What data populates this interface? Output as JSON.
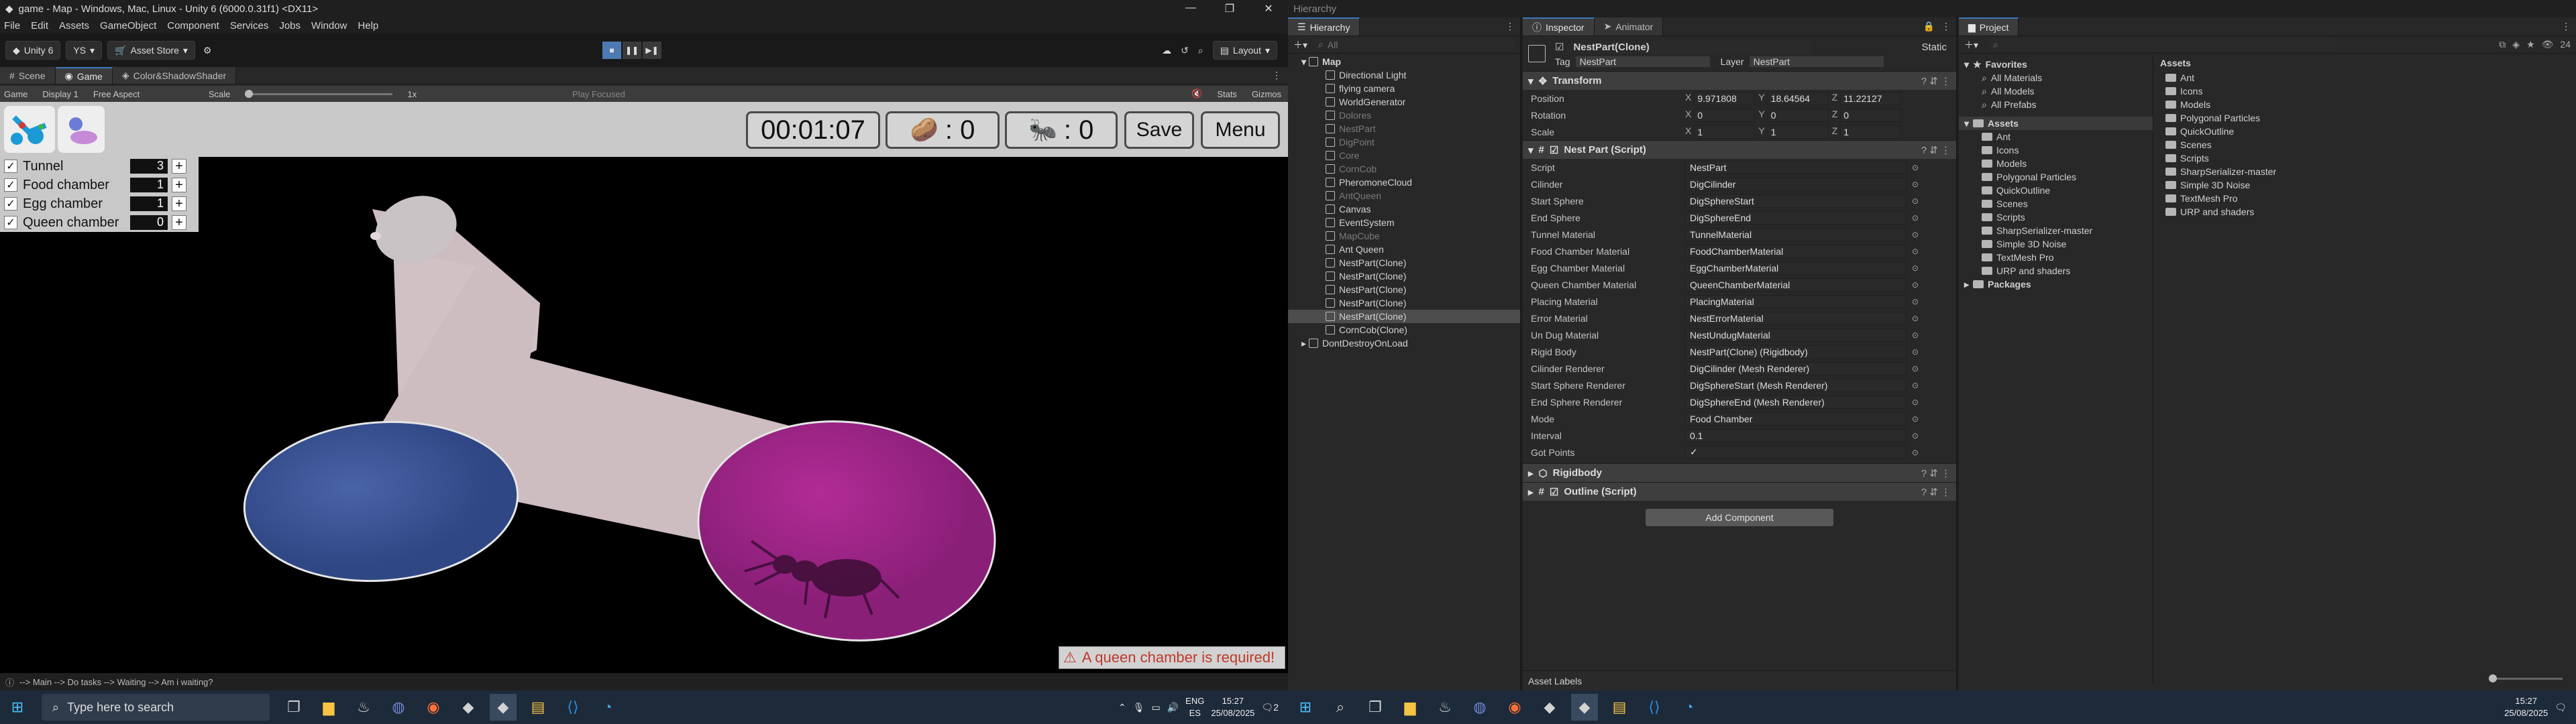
{
  "window": {
    "title": "game - Map - Windows, Mac, Linux - Unity 6 (6000.0.31f1) <DX11>",
    "controls": [
      "—",
      "❐",
      "✕"
    ]
  },
  "menu": [
    "File",
    "Edit",
    "Assets",
    "GameObject",
    "Component",
    "Services",
    "Jobs",
    "Window",
    "Help"
  ],
  "toolbar": {
    "unity": "Unity 6",
    "account": "YS",
    "store": "Asset Store",
    "layout": "Layout"
  },
  "scene_tabs": [
    "Scene",
    "Game",
    "Color&ShadowShader"
  ],
  "gamebar": {
    "mode": "Game",
    "display": "Display 1",
    "aspect": "Free Aspect",
    "scale_label": "Scale",
    "scale_value": "1x",
    "play_focused": "Play Focused",
    "stats": "Stats",
    "gizmos": "Gizmos"
  },
  "hud": {
    "timer": "00:01:07",
    "food_count": ": 0",
    "ant_count": ": 0",
    "save": "Save",
    "menu": "Menu"
  },
  "legend": [
    {
      "label": "Tunnel",
      "value": "3"
    },
    {
      "label": "Food chamber",
      "value": "1"
    },
    {
      "label": "Egg chamber",
      "value": "1"
    },
    {
      "label": "Queen chamber",
      "value": "0"
    }
  ],
  "warning": "A queen chamber is required!",
  "status": "--> Main --> Do tasks --> Waiting --> Am i waiting?",
  "taskbar": {
    "search": "Type here to search",
    "lang": "ENG",
    "region": "ES",
    "time": "15:27",
    "date": "25/08/2025",
    "notif": "2"
  },
  "hierarchy": {
    "tab": "Hierarchy",
    "search": "All",
    "root": "Map",
    "items": [
      {
        "label": "Directional Light",
        "dim": false,
        "sel": false
      },
      {
        "label": "flying camera",
        "dim": false,
        "sel": false
      },
      {
        "label": "WorldGenerator",
        "dim": false,
        "sel": false
      },
      {
        "label": "Dolores",
        "dim": true,
        "sel": false
      },
      {
        "label": "NestPart",
        "dim": true,
        "sel": false
      },
      {
        "label": "DigPoint",
        "dim": true,
        "sel": false
      },
      {
        "label": "Core",
        "dim": true,
        "sel": false
      },
      {
        "label": "CornCob",
        "dim": true,
        "sel": false
      },
      {
        "label": "PheromoneCloud",
        "dim": false,
        "sel": false
      },
      {
        "label": "AntQueen",
        "dim": true,
        "sel": false
      },
      {
        "label": "Canvas",
        "dim": false,
        "sel": false
      },
      {
        "label": "EventSystem",
        "dim": false,
        "sel": false
      },
      {
        "label": "MapCube",
        "dim": true,
        "sel": false
      },
      {
        "label": "Ant Queen",
        "dim": false,
        "sel": false
      },
      {
        "label": "NestPart(Clone)",
        "dim": false,
        "sel": false
      },
      {
        "label": "NestPart(Clone)",
        "dim": false,
        "sel": false
      },
      {
        "label": "NestPart(Clone)",
        "dim": false,
        "sel": false
      },
      {
        "label": "NestPart(Clone)",
        "dim": false,
        "sel": false
      },
      {
        "label": "NestPart(Clone)",
        "dim": false,
        "sel": true
      },
      {
        "label": "CornCob(Clone)",
        "dim": false,
        "sel": false
      }
    ],
    "dontdestroy": "DontDestroyOnLoad"
  },
  "inspector": {
    "tabs": [
      "Inspector",
      "Animator"
    ],
    "object": "NestPart(Clone)",
    "static": "Static",
    "tag_label": "Tag",
    "tag": "NestPart",
    "layer_label": "Layer",
    "layer": "NestPart",
    "transform": {
      "title": "Transform",
      "position_label": "Position",
      "position": [
        "9.971808",
        "18.64564",
        "11.22127"
      ],
      "rotation_label": "Rotation",
      "rotation": [
        "0",
        "0",
        "0"
      ],
      "scale_label": "Scale",
      "scale": [
        "1",
        "1",
        "1"
      ]
    },
    "script": {
      "title": "Nest Part (Script)",
      "fields": [
        {
          "k": "Script",
          "v": "NestPart"
        },
        {
          "k": "Cilinder",
          "v": "DigCilinder"
        },
        {
          "k": "Start Sphere",
          "v": "DigSphereStart"
        },
        {
          "k": "End Sphere",
          "v": "DigSphereEnd"
        },
        {
          "k": "Tunnel Material",
          "v": "TunnelMaterial"
        },
        {
          "k": "Food Chamber Material",
          "v": "FoodChamberMaterial"
        },
        {
          "k": "Egg Chamber Material",
          "v": "EggChamberMaterial"
        },
        {
          "k": "Queen Chamber Material",
          "v": "QueenChamberMaterial"
        },
        {
          "k": "Placing Material",
          "v": "PlacingMaterial"
        },
        {
          "k": "Error Material",
          "v": "NestErrorMaterial"
        },
        {
          "k": "Un Dug Material",
          "v": "NestUndugMaterial"
        },
        {
          "k": "Rigid Body",
          "v": "NestPart(Clone) (Rigidbody)"
        },
        {
          "k": "Cilinder Renderer",
          "v": "DigCilinder (Mesh Renderer)"
        },
        {
          "k": "Start Sphere Renderer",
          "v": "DigSphereStart (Mesh Renderer)"
        },
        {
          "k": "End Sphere Renderer",
          "v": "DigSphereEnd (Mesh Renderer)"
        },
        {
          "k": "Mode",
          "v": "Food Chamber"
        },
        {
          "k": "Interval",
          "v": "0.1"
        },
        {
          "k": "Got Points",
          "v": "✓"
        }
      ]
    },
    "rigidbody": "Rigidbody",
    "outline": "Outline (Script)",
    "add_component": "Add Component",
    "asset_labels": "Asset Labels"
  },
  "project": {
    "tab": "Project",
    "favorites": "Favorites",
    "fav_items": [
      "All Materials",
      "All Models",
      "All Prefabs"
    ],
    "assets": "Assets",
    "tree": [
      "Ant",
      "Icons",
      "Models",
      "Polygonal Particles",
      "QuickOutline",
      "Scenes",
      "Scripts",
      "SharpSerializer-master",
      "Simple 3D Noise",
      "TextMesh Pro",
      "URP and shaders"
    ],
    "packages": "Packages",
    "grid_title": "Assets",
    "grid": [
      "Ant",
      "Icons",
      "Models",
      "Polygonal Particles",
      "QuickOutline",
      "Scenes",
      "Scripts",
      "SharpSerializer-master",
      "Simple 3D Noise",
      "TextMesh Pro",
      "URP and shaders"
    ],
    "count": "24"
  },
  "colors": {
    "egg": "#3f5a98",
    "food": "#a3258a",
    "tunnel": "#cdbcc0",
    "accent": "#3a79bb"
  }
}
